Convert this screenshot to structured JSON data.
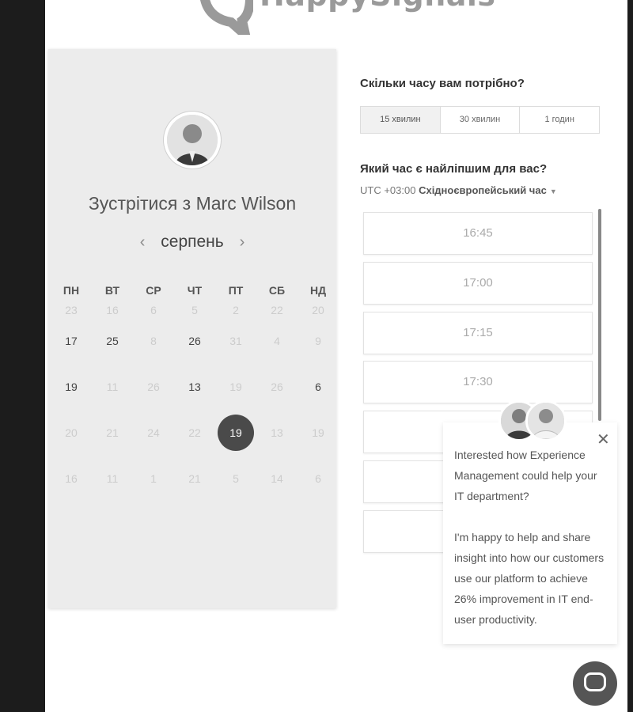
{
  "brand": {
    "name": "HappySignals"
  },
  "host_card": {
    "title": "Зустрітися з Marc Wilson",
    "month": "серпень",
    "prev_icon": "chevron-left-icon",
    "next_icon": "chevron-right-icon",
    "weekdays": [
      "ПН",
      "ВТ",
      "СР",
      "ЧТ",
      "ПТ",
      "СБ",
      "НД"
    ],
    "weeks": [
      [
        "23",
        "16",
        "6",
        "5",
        "2",
        "22",
        "20"
      ],
      [
        "17",
        "25",
        "8",
        "26",
        "31",
        "4",
        "9"
      ],
      [
        "19",
        "11",
        "26",
        "13",
        "19",
        "26",
        "6"
      ],
      [
        "20",
        "21",
        "24",
        "22",
        "19",
        "13",
        "19"
      ],
      [
        "16",
        "11",
        "1",
        "21",
        "5",
        "14",
        "6"
      ]
    ],
    "selected_day": "19"
  },
  "duration": {
    "question": "Скільки часу вам потрібно?",
    "options": [
      "15 хвилин",
      "30 хвилин",
      "1 годин"
    ],
    "selected": "15 хвилин"
  },
  "time": {
    "question": "Який час є найліпшим для вас?",
    "tz_offset": "UTC +03:00",
    "tz_name": "Східноєвропейський час",
    "slots": [
      "16:45",
      "17:00",
      "17:15",
      "17:30",
      "",
      "",
      ""
    ]
  },
  "chat": {
    "message_1": "Interested how Experience Management could help your IT department?",
    "message_2": "I'm happy to help and share insight into how our customers use our platform to achieve 26% improvement in IT end-user productivity.",
    "close_icon": "close-icon",
    "launcher_icon": "chat-bubble-icon"
  }
}
